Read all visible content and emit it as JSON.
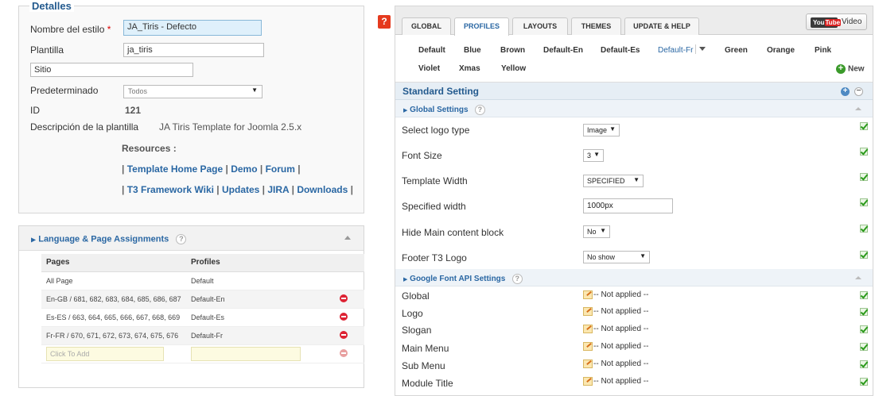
{
  "details": {
    "legend": "Detalles",
    "nombre_label": "Nombre del estilo",
    "nombre_req": "*",
    "nombre_value": "JA_Tiris - Defecto",
    "plantilla_label": "Plantilla",
    "plantilla_value": "ja_tiris",
    "sitio_value": "Sitio",
    "predeterminado_label": "Predeterminado",
    "predeterminado_value": "Todos",
    "id_label": "ID",
    "id_value": "121",
    "descripcion_label": "Descripción de la plantilla",
    "descripcion_value": "JA Tiris Template for Joomla 2.5.x",
    "resources_label": "Resources :",
    "links": {
      "template_home": "Template Home Page",
      "demo": "Demo",
      "forum": "Forum",
      "t3_wiki": "T3 Framework Wiki",
      "updates": "Updates",
      "jira": "JIRA",
      "downloads": "Downloads"
    }
  },
  "assignments": {
    "title": "Language & Page Assignments",
    "qmark": "?",
    "columns": [
      "Pages",
      "Profiles"
    ],
    "rows": [
      {
        "page": "All Page",
        "profile": "Default"
      },
      {
        "page": "En-GB / 681, 682, 683, 684, 685, 686, 687",
        "profile": "Default-En"
      },
      {
        "page": "Es-ES / 663, 664, 665, 666, 667, 668, 669",
        "profile": "Default-Es"
      },
      {
        "page": "Fr-FR / 670, 671, 672, 673, 674, 675, 676",
        "profile": "Default-Fr"
      }
    ],
    "add_placeholder": "Click To Add"
  },
  "help_icon": "?",
  "tabs": [
    "GLOBAL",
    "PROFILES",
    "LAYOUTS",
    "THEMES",
    "UPDATE & HELP"
  ],
  "active_tab": "PROFILES",
  "video": {
    "yt_you": "You",
    "yt_tube": "Tube",
    "label": "Video"
  },
  "profiles": {
    "row1": [
      "Default",
      "Blue",
      "Brown",
      "Default-En",
      "Default-Es",
      "Default-Fr",
      "Green",
      "Orange",
      "Pink"
    ],
    "row2": [
      "Violet",
      "Xmas",
      "Yellow"
    ],
    "active": "Default-Fr",
    "new_label": "New"
  },
  "standard": {
    "title": "Standard Setting",
    "plus": "+",
    "minus": "−"
  },
  "global_settings": {
    "title": "Global Settings",
    "qmark": "?",
    "items": [
      {
        "label": "Select logo type",
        "value": "Image"
      },
      {
        "label": "Font Size",
        "value": "3"
      },
      {
        "label": "Template Width",
        "value": "SPECIFIED"
      },
      {
        "label": "Specified width",
        "value": "1000px"
      },
      {
        "label": "Hide Main content block",
        "value": "No"
      },
      {
        "label": "Footer T3 Logo",
        "value": "No show"
      }
    ]
  },
  "google_font": {
    "title": "Google Font API Settings",
    "qmark": "?",
    "not_applied": "-- Not applied --",
    "items": [
      "Global",
      "Logo",
      "Slogan",
      "Main Menu",
      "Sub Menu",
      "Module Title"
    ]
  },
  "colors": {
    "accent": "#2a67a3",
    "help_red": "#e53a1e",
    "check_green": "#2a9a1a"
  }
}
